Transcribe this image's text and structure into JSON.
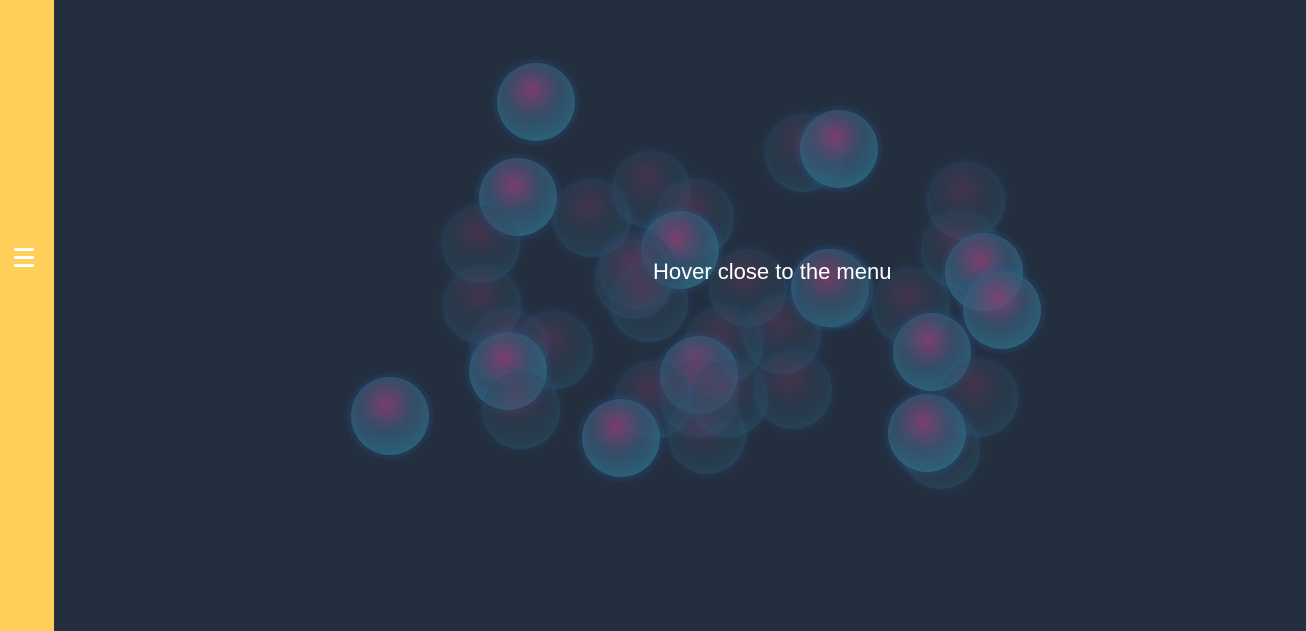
{
  "sidebar": {
    "background": "#ffcf5a",
    "menu_icon": "hamburger-menu-icon"
  },
  "main": {
    "background": "#232f3f",
    "hint_text": "Hover close to the menu"
  },
  "bubble_colors": {
    "core": "#7a3f6a",
    "rim": "#2a6f87"
  }
}
